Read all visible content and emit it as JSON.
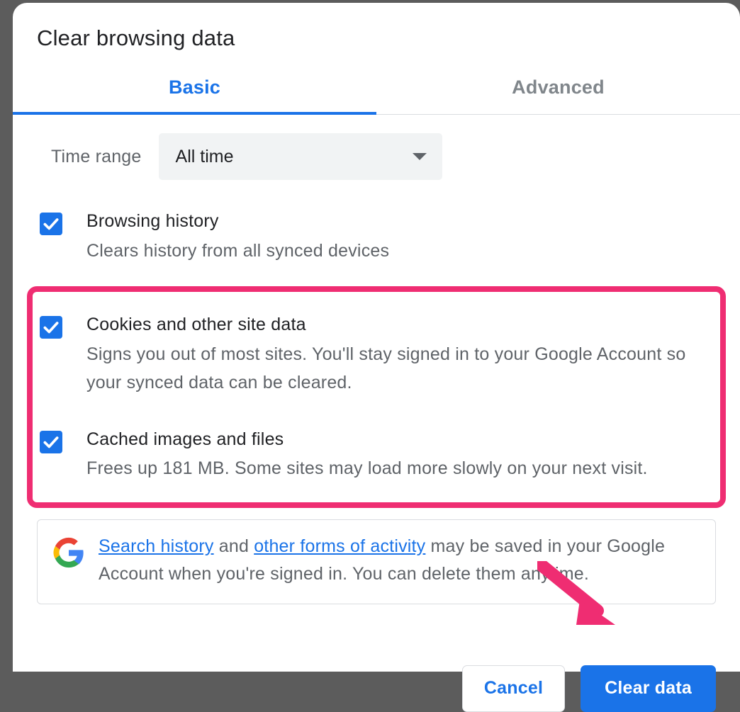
{
  "title": "Clear browsing data",
  "tabs": {
    "basic": "Basic",
    "advanced": "Advanced"
  },
  "time_range": {
    "label": "Time range",
    "value": "All time"
  },
  "options": {
    "history": {
      "title": "Browsing history",
      "desc": "Clears history from all synced devices"
    },
    "cookies": {
      "title": "Cookies and other site data",
      "desc": "Signs you out of most sites. You'll stay signed in to your Google Account so your synced data can be cleared."
    },
    "cache": {
      "title": "Cached images and files",
      "desc": "Frees up 181 MB. Some sites may load more slowly on your next visit."
    }
  },
  "info": {
    "link1": "Search history",
    "mid1": " and ",
    "link2": "other forms of activity",
    "rest": " may be saved in your Google Account when you're signed in. You can delete them anytime."
  },
  "buttons": {
    "cancel": "Cancel",
    "clear": "Clear data"
  },
  "colors": {
    "accent": "#1a73e8",
    "highlight": "#ef2d72"
  }
}
